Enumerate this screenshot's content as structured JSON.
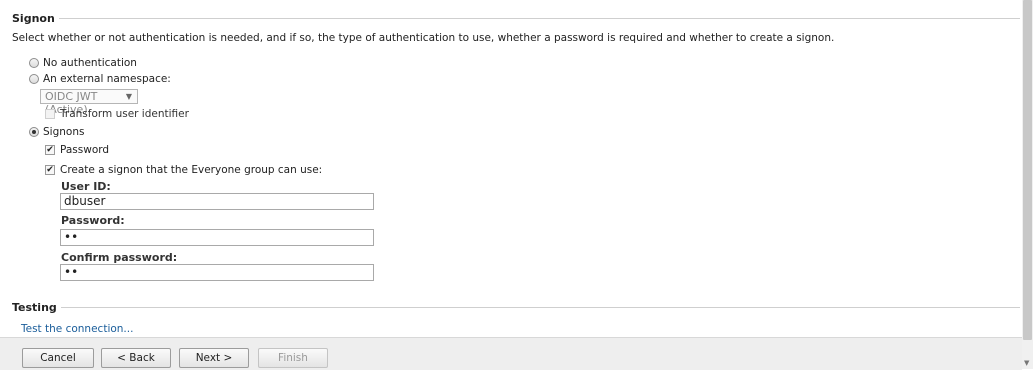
{
  "signon": {
    "title": "Signon",
    "description": "Select whether or not authentication is needed, and if so, the type of authentication to use, whether a password is required and whether to create a signon.",
    "options": {
      "no_auth": "No authentication",
      "external_namespace": "An external namespace:",
      "namespace_select": "OIDC JWT (Active)",
      "transform_user_identifier": "Transform user identifier",
      "signons": "Signons",
      "password": "Password",
      "create_signon": "Create a signon that the Everyone group can use:"
    },
    "fields": {
      "user_id_label": "User ID:",
      "user_id_value": "dbuser",
      "password_label": "Password:",
      "password_value": "••",
      "confirm_password_label": "Confirm password:",
      "confirm_password_value": "••"
    }
  },
  "testing": {
    "title": "Testing",
    "link": "Test the connection..."
  },
  "footer": {
    "cancel": "Cancel",
    "back": "< Back",
    "next": "Next >",
    "finish": "Finish"
  }
}
